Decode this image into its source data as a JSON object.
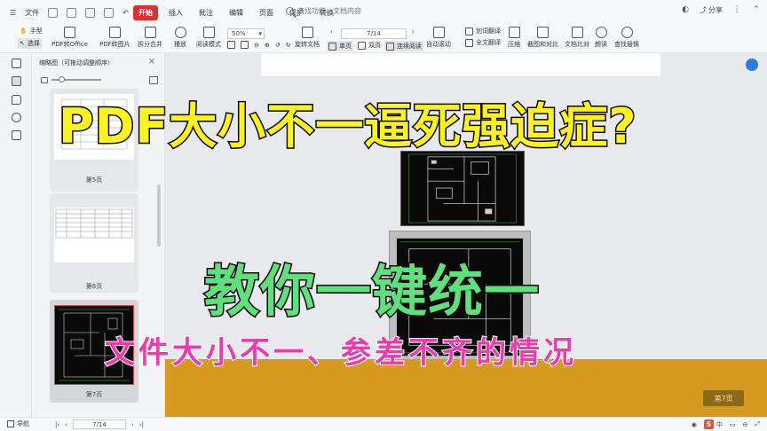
{
  "menubar": {
    "items": [
      "文件",
      "开始",
      "插入",
      "批注",
      "编辑",
      "页面",
      "保护",
      "转换"
    ],
    "file_label": "文件",
    "search_placeholder": "查找功能、文档内容",
    "share_label": "分享"
  },
  "tabs": [
    {
      "label": "开始",
      "active": true
    },
    {
      "label": "插入",
      "active": false
    },
    {
      "label": "批注",
      "active": false
    },
    {
      "label": "编辑",
      "active": false
    },
    {
      "label": "页面",
      "active": false
    },
    {
      "label": "保护",
      "active": false
    },
    {
      "label": "转换",
      "active": false
    }
  ],
  "ribbon": {
    "hand": "手型",
    "select": "选择",
    "pdf_to_office": "PDF转Office",
    "pdf_to_image": "PDF转图片",
    "split_merge": "拆分合并",
    "play": "播放",
    "read_mode": "阅读模式",
    "zoom": "50%",
    "rotate": "旋转文档",
    "single": "单页",
    "double": "双页",
    "continuous": "连续阅读",
    "auto_scroll": "自动滚动",
    "page": "7/14",
    "word_translate": "划词翻译",
    "full_translate": "全文翻译",
    "compress": "压缩",
    "screenshot_compare": "截图和对比",
    "doc_compare": "文档比对",
    "read_aloud": "朗读",
    "find_replace": "查找替换"
  },
  "thumbnail_panel": {
    "title": "缩略图（可拖动调整顺序）",
    "pages": [
      "第5页",
      "第6页",
      "第7页"
    ]
  },
  "overlay": {
    "headline": "PDF大小不一逼死强迫症?",
    "subheadline": "教你一键统一",
    "caption": "文件大小不一、参差不齐的情况"
  },
  "document": {
    "page_indicator": "第7页"
  },
  "statusbar": {
    "nav_label": "导航",
    "page": "7/14",
    "ime_label": "中"
  },
  "colors": {
    "accent_red": "#e02f2f",
    "headline_yellow": "#fbf21e",
    "headline_green": "#5fe07c",
    "caption_pink": "#ef3aa9"
  }
}
